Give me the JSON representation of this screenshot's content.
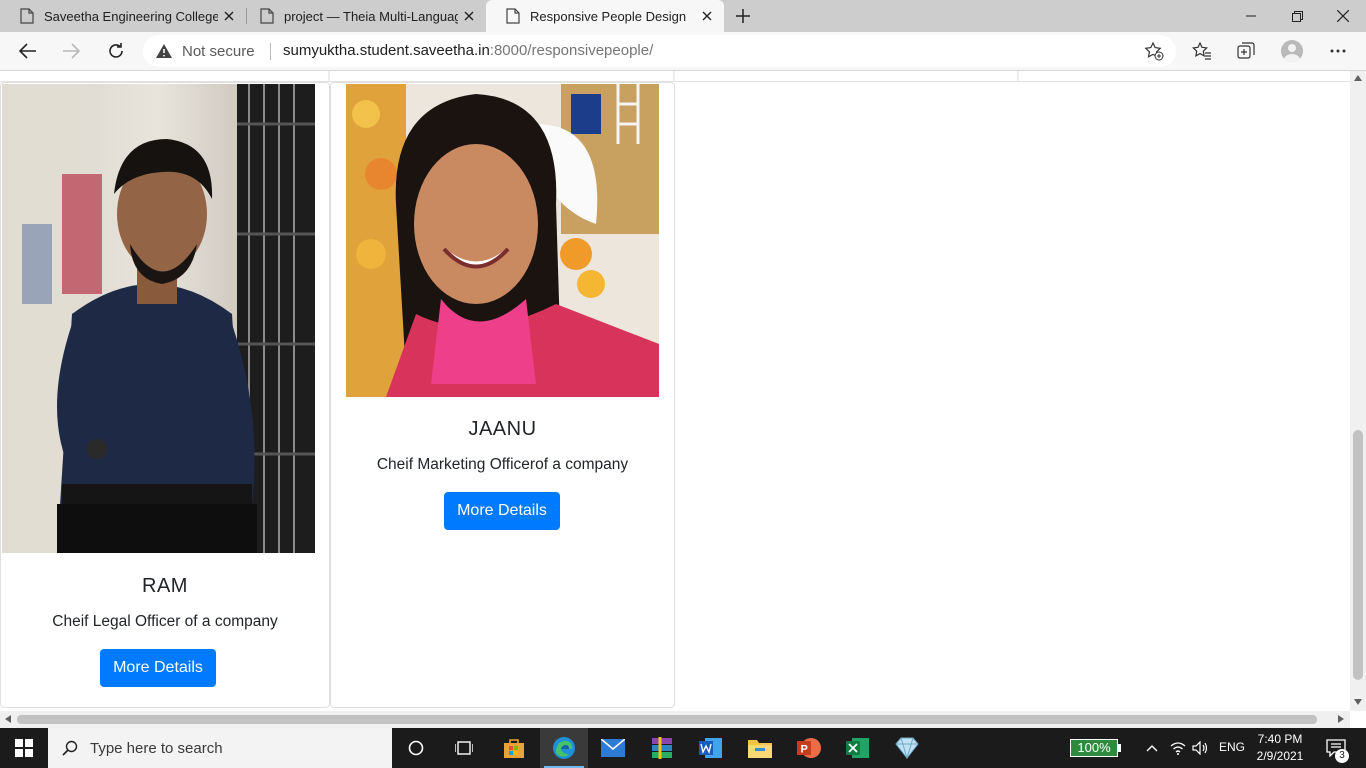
{
  "browser": {
    "tabs": [
      {
        "title": "Saveetha Engineering College",
        "active": false
      },
      {
        "title": "project — Theia Multi-Language",
        "active": false
      },
      {
        "title": "Responsive People Design",
        "active": true
      }
    ],
    "address": {
      "security_label": "Not secure",
      "host": "sumyuktha.student.saveetha.in",
      "port_path": ":8000/responsivepeople/"
    }
  },
  "page": {
    "cards": [
      {
        "name": "RAM",
        "role": "Cheif Legal Officer of a company",
        "button_label": "More Details"
      },
      {
        "name": "JAANU",
        "role": "Cheif Marketing Officerof a company",
        "button_label": "More Details"
      }
    ]
  },
  "taskbar": {
    "search_placeholder": "Type here to search",
    "battery": "100%",
    "language": "ENG",
    "time": "7:40 PM",
    "date": "2/9/2021",
    "notification_count": "3"
  },
  "colors": {
    "primary_button": "#007bff",
    "taskbar": "#1b1b1b",
    "tabstrip": "#cdcdcd"
  }
}
